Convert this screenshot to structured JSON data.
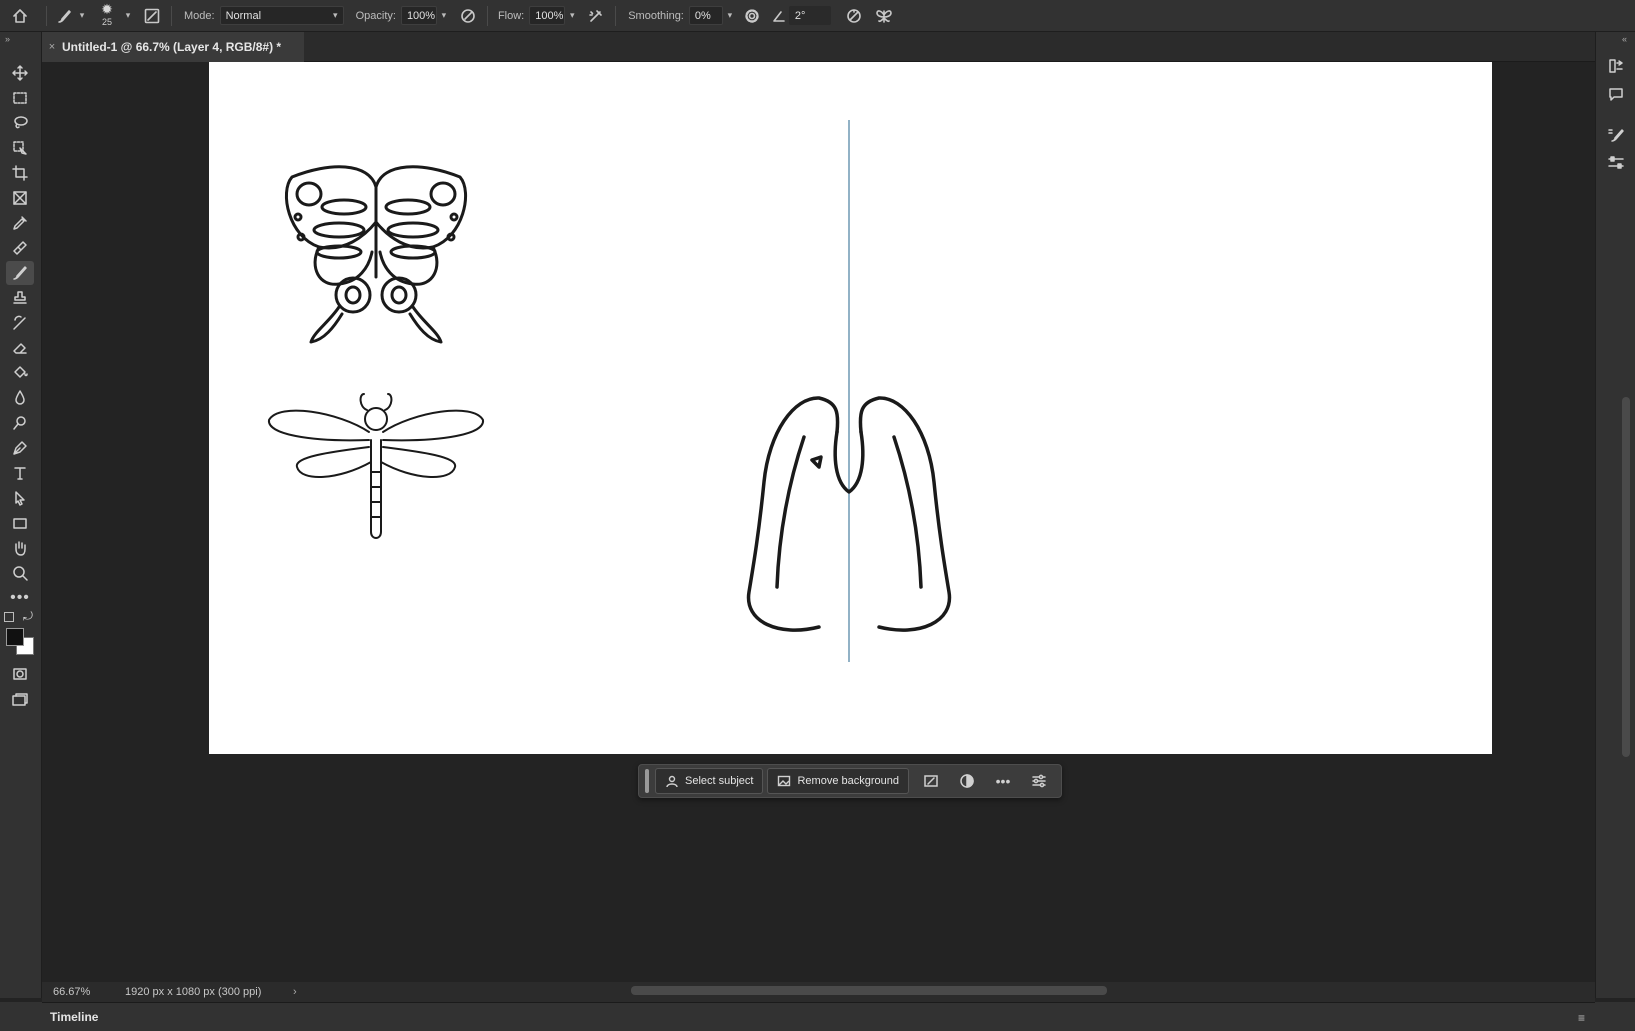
{
  "optionsbar": {
    "brush_size": "25",
    "mode_label": "Mode:",
    "mode_value": "Normal",
    "opacity_label": "Opacity:",
    "opacity_value": "100%",
    "flow_label": "Flow:",
    "flow_value": "100%",
    "smoothing_label": "Smoothing:",
    "smoothing_value": "0%",
    "angle_value": "2°"
  },
  "document": {
    "tab_title": "Untitled-1 @ 66.7% (Layer 4, RGB/8#) *",
    "tab_close": "×"
  },
  "toolbar": {
    "tools": [
      "move-tool",
      "rectangular-marquee-tool",
      "lasso-tool",
      "object-selection-tool",
      "crop-tool",
      "frame-tool",
      "eyedropper-tool",
      "spot-healing-tool",
      "brush-tool",
      "clone-stamp-tool",
      "history-brush-tool",
      "eraser-tool",
      "paint-bucket-tool",
      "blur-tool",
      "dodge-tool",
      "pen-tool",
      "type-tool",
      "path-selection-tool",
      "rectangle-tool",
      "hand-tool",
      "zoom-tool",
      "more-tools"
    ],
    "active_tool": "brush-tool",
    "foreground_color": "#111111",
    "background_color": "#ffffff"
  },
  "contextual_bar": {
    "select_subject": "Select subject",
    "remove_background": "Remove background"
  },
  "status": {
    "zoom": "66.67%",
    "doc_info": "1920 px x 1080 px (300 ppi)",
    "arrow": "›"
  },
  "timeline": {
    "label": "Timeline"
  },
  "colors": {
    "panel_bg": "#323232",
    "workspace_bg": "#232323",
    "canvas_bg": "#ffffff",
    "symmetry_axis": "#4a7fa0"
  }
}
